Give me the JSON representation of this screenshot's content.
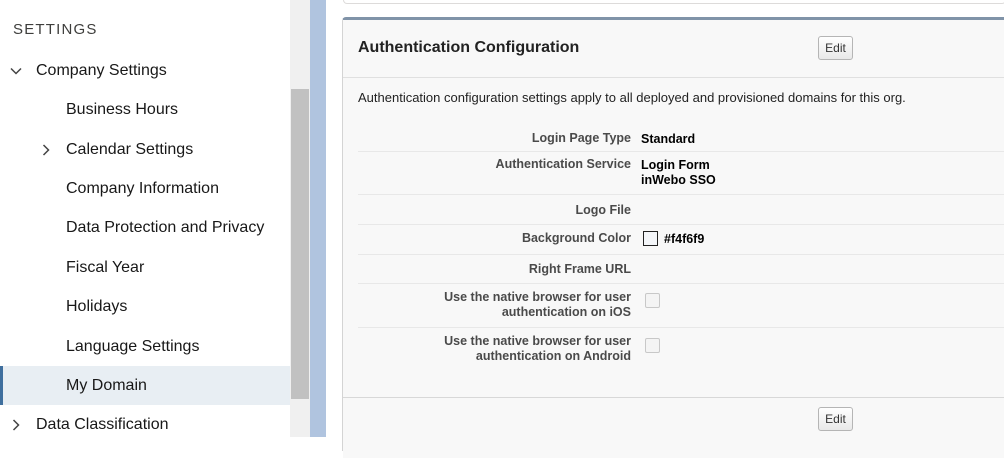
{
  "sidebar": {
    "heading": "SETTINGS",
    "items": [
      {
        "label": "Company Settings",
        "chevron": "chevron-down-icon"
      },
      {
        "label": "Business Hours"
      },
      {
        "label": "Calendar Settings",
        "chevron": "chevron-right-icon"
      },
      {
        "label": "Company Information"
      },
      {
        "label": "Data Protection and Privacy"
      },
      {
        "label": "Fiscal Year"
      },
      {
        "label": "Holidays"
      },
      {
        "label": "Language Settings"
      },
      {
        "label": "My Domain",
        "selected": true
      },
      {
        "label": "Data Classification",
        "chevron": "chevron-right-icon"
      }
    ]
  },
  "panel": {
    "title": "Authentication Configuration",
    "edit_label": "Edit",
    "description": "Authentication configuration settings apply to all deployed and provisioned domains for this org.",
    "fields": {
      "login_page_type": {
        "label": "Login Page Type",
        "value": "Standard"
      },
      "auth_service": {
        "label": "Authentication Service",
        "value_line1": "Login Form",
        "value_line2": "inWebo SSO"
      },
      "logo_file": {
        "label": "Logo File",
        "value": ""
      },
      "background_color": {
        "label": "Background Color",
        "value": "#f4f6f9"
      },
      "right_frame_url": {
        "label": "Right Frame URL",
        "value": ""
      },
      "native_ios": {
        "label_line1": "Use the native browser for user",
        "label_line2": "authentication on iOS",
        "checked": false
      },
      "native_android": {
        "label_line1": "Use the native browser for user",
        "label_line2": "authentication on Android",
        "checked": false
      }
    }
  },
  "colors": {
    "accent": "#3f6f9e",
    "page_background": "#b0c4df",
    "selected_item": "#e8eef3"
  }
}
